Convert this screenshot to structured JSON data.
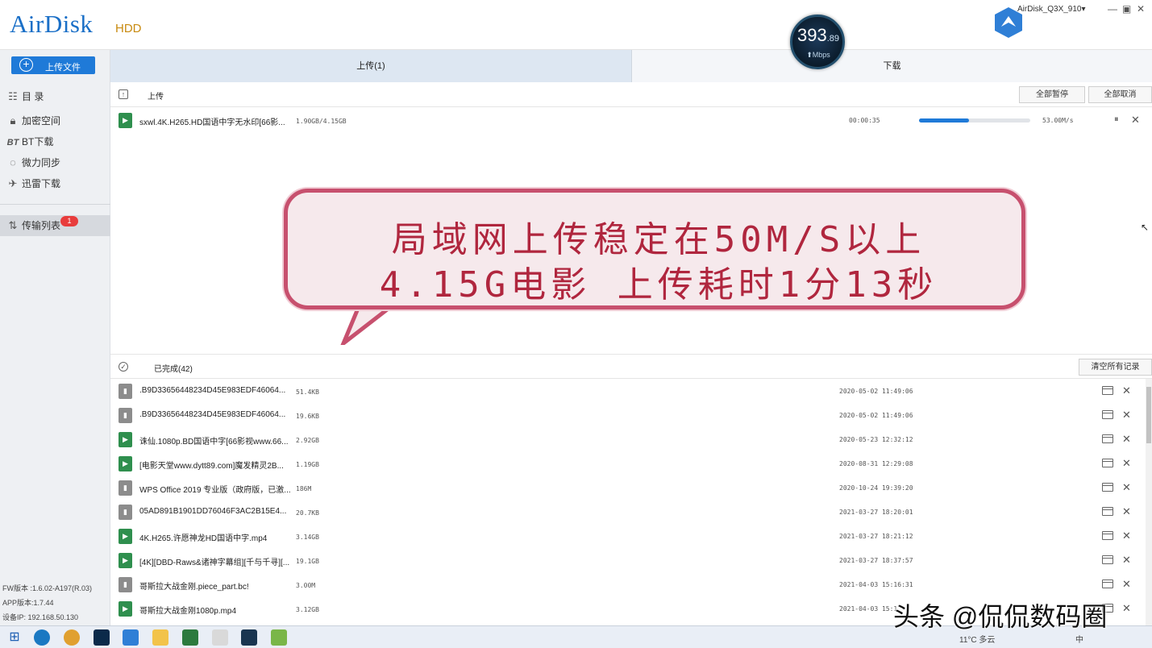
{
  "app": {
    "logo": "AirDisk",
    "logo_sub": "HDD",
    "device_name": "AirDisk_Q3X_910▾",
    "speed": {
      "main": "393",
      "dec": ".89",
      "unit": "Mbps"
    }
  },
  "sidebar": {
    "upload_label": "上传文件",
    "items": [
      {
        "icon": "list-icon",
        "label": "目 录"
      },
      {
        "icon": "lock-icon",
        "label": "加密空间"
      },
      {
        "icon": "bt-icon",
        "label": "BT下载"
      },
      {
        "icon": "sync-icon",
        "label": "微力同步"
      },
      {
        "icon": "thunder-icon",
        "label": "迅雷下载"
      }
    ],
    "transfer_label": "传输列表",
    "transfer_badge": "1",
    "fw": "FW版本 :1.6.02-A197(R.03)",
    "app_version": "APP版本:1.7.44",
    "ip": "设备IP: 192.168.50.130"
  },
  "tabs": {
    "upload": "上传(1)",
    "download": "下载"
  },
  "upload_section": {
    "title": "上传",
    "pause_all": "全部暂停",
    "cancel_all": "全部取消",
    "active": {
      "name": "sxwl.4K.H265.HD国语中字无水印[66影...",
      "size": "1.90GB/4.15GB",
      "eta": "00:00:35",
      "progress": 0.45,
      "speed": "53.00M/s"
    }
  },
  "callout": {
    "line1": "局域网上传稳定在50M/S以上",
    "line2": "4.15G电影  上传耗时1分13秒"
  },
  "completed_section": {
    "title": "已完成(42)",
    "clear_all": "清空所有记录",
    "rows": [
      {
        "type": "grey",
        "name": ".B9D33656448234D45E983EDF46064...",
        "size": "51.4KB",
        "date": "2020-05-02 11:49:06"
      },
      {
        "type": "grey",
        "name": ".B9D33656448234D45E983EDF46064...",
        "size": "19.6KB",
        "date": "2020-05-02 11:49:06"
      },
      {
        "type": "green",
        "name": "诛仙.1080p.BD国语中字[66影视www.66...",
        "size": "2.92GB",
        "date": "2020-05-23 12:32:12"
      },
      {
        "type": "green",
        "name": "[电影天堂www.dytt89.com]魔发精灵2B...",
        "size": "1.19GB",
        "date": "2020-08-31 12:29:08"
      },
      {
        "type": "grey",
        "name": "WPS Office 2019 专业版（政府版，已激...",
        "size": "186M",
        "date": "2020-10-24 19:39:20"
      },
      {
        "type": "grey",
        "name": "05AD891B1901DD76046F3AC2B15E4...",
        "size": "20.7KB",
        "date": "2021-03-27 18:20:01"
      },
      {
        "type": "green",
        "name": "4K.H265.许愿神龙HD国语中字.mp4",
        "size": "3.14GB",
        "date": "2021-03-27 18:21:12"
      },
      {
        "type": "green",
        "name": "[4K][DBD-Raws&诸神字幕组][千与千寻][...",
        "size": "19.1GB",
        "date": "2021-03-27 18:37:57"
      },
      {
        "type": "grey",
        "name": "哥斯拉大战金刚.piece_part.bc!",
        "size": "3.00M",
        "date": "2021-04-03 15:16:31"
      },
      {
        "type": "green",
        "name": "哥斯拉大战金刚1080p.mp4",
        "size": "3.12GB",
        "date": "2021-04-03 15:1"
      }
    ]
  },
  "watermark": "头条 @侃侃数码圈",
  "taskbar": {
    "weather": "11°C 多云",
    "ime": "中"
  }
}
